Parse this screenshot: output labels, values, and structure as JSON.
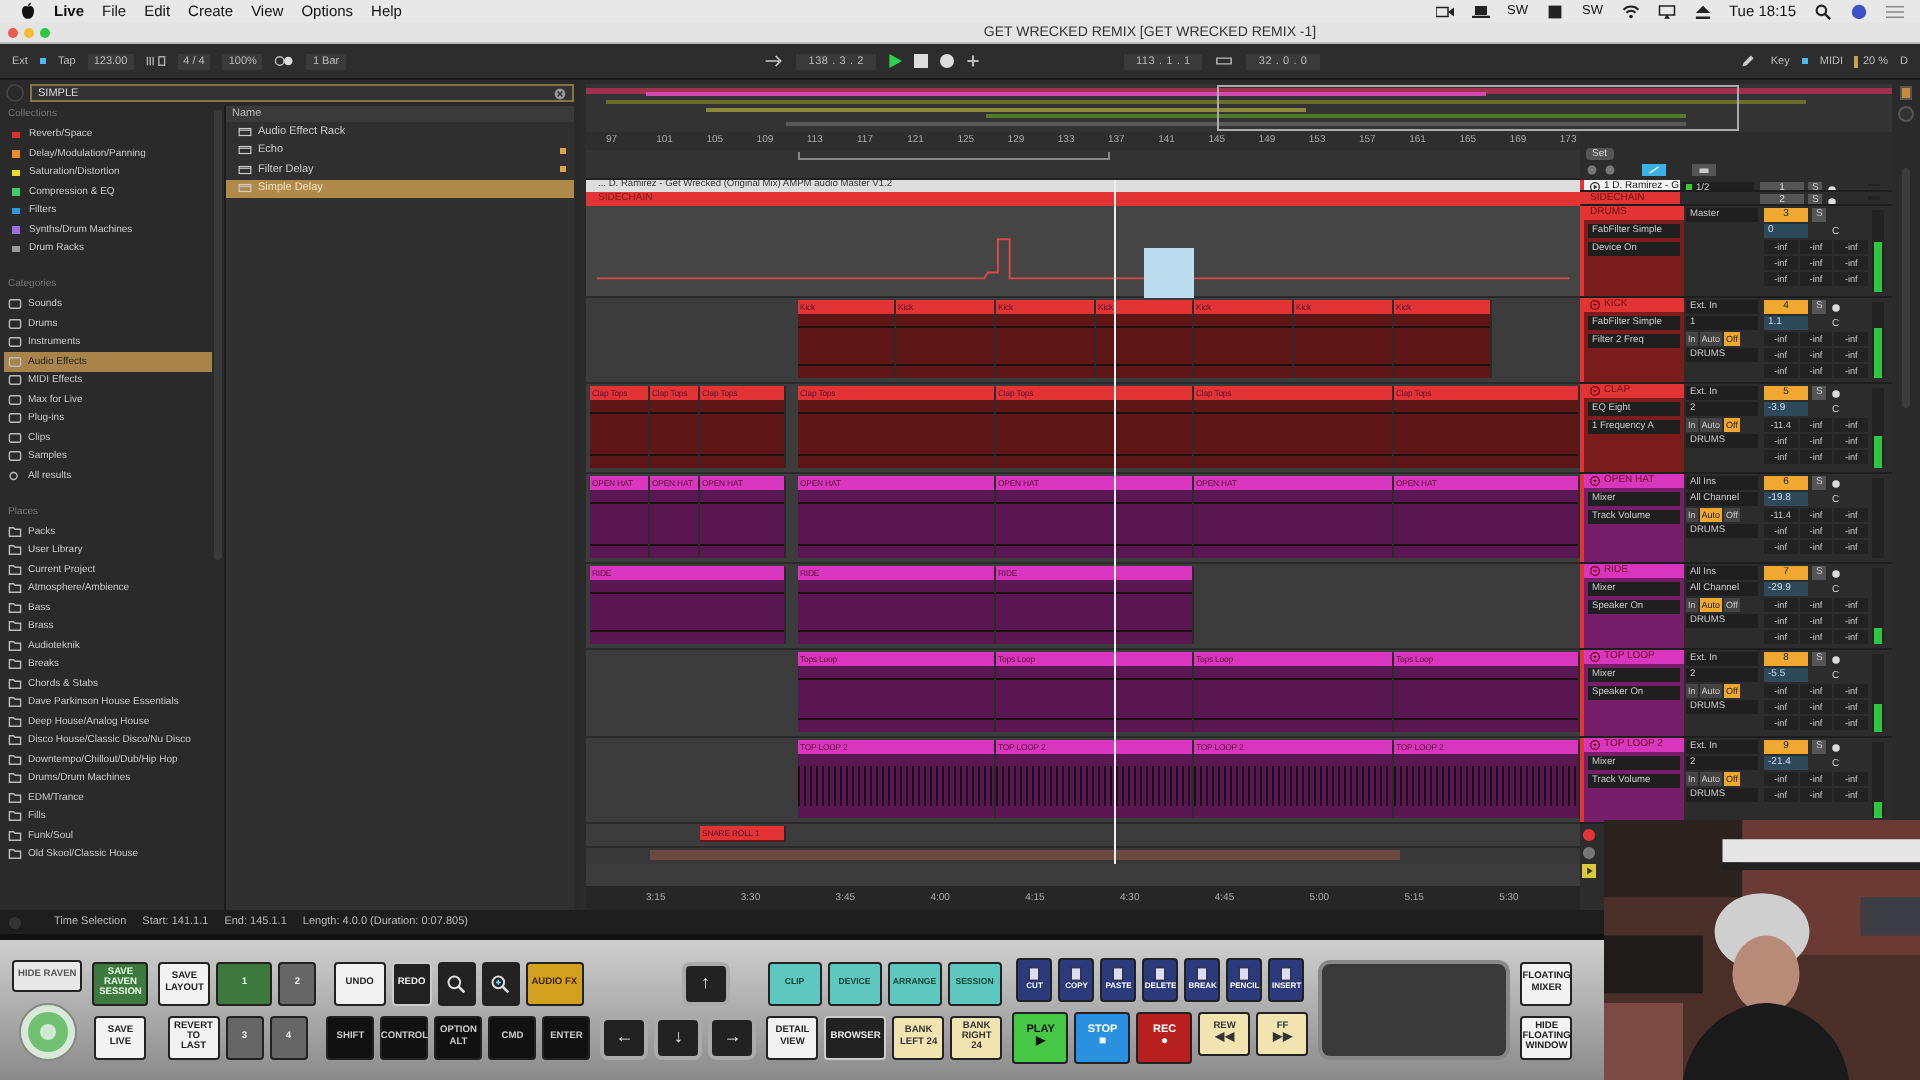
{
  "menubar": {
    "app": "Live",
    "menus": [
      "File",
      "Edit",
      "Create",
      "View",
      "Options",
      "Help"
    ],
    "extras": [
      "SW",
      "SW"
    ],
    "clock": "Tue 18:15"
  },
  "window": {
    "title": "GET WRECKED REMIX  [GET WRECKED REMIX -1]"
  },
  "control_bar": {
    "ext": "Ext",
    "tap": "Tap",
    "tempo": "123.00",
    "signature": "4 / 4",
    "zoom": "100%",
    "quantize": "1 Bar",
    "position": "138 .  3 .  2",
    "loop_start": "113 .  1 .  1",
    "loop_length": "32 .  0 .  0",
    "key": "Key",
    "midi": "MIDI",
    "cpu": "20 %",
    "disk": "D"
  },
  "browser": {
    "search": "SIMPLE",
    "collections_heading": "Collections",
    "collections": [
      {
        "label": "Reverb/Space",
        "color": "#e0302a"
      },
      {
        "label": "Delay/Modulation/Panning",
        "color": "#f08a24"
      },
      {
        "label": "Saturation/Distortion",
        "color": "#e8e02a"
      },
      {
        "label": "Compression & EQ",
        "color": "#3fd06a"
      },
      {
        "label": "Filters",
        "color": "#2a9ad8"
      },
      {
        "label": "Synths/Drum Machines",
        "color": "#9a6fe0"
      },
      {
        "label": "Drum Racks",
        "color": "#9a9a9a"
      }
    ],
    "categories_heading": "Categories",
    "categories": [
      {
        "label": "Sounds",
        "selected": false
      },
      {
        "label": "Drums",
        "selected": false
      },
      {
        "label": "Instruments",
        "selected": false
      },
      {
        "label": "Audio Effects",
        "selected": true
      },
      {
        "label": "MIDI Effects",
        "selected": false
      },
      {
        "label": "Max for Live",
        "selected": false
      },
      {
        "label": "Plug-ins",
        "selected": false
      },
      {
        "label": "Clips",
        "selected": false
      },
      {
        "label": "Samples",
        "selected": false
      },
      {
        "label": "All results",
        "selected": false
      }
    ],
    "places_heading": "Places",
    "places": [
      "Packs",
      "User Library",
      "Current Project",
      "Atmosphere/Ambience",
      "Bass",
      "Brass",
      "Audioteknik",
      "Breaks",
      "Chords & Stabs",
      "Dave Parkinson House Essentials",
      "Deep House/Analog House",
      "Disco House/Classic Disco/Nu Disco",
      "Downtempo/Chillout/Dub/Hip Hop",
      "Drums/Drum Machines",
      "EDM/Trance",
      "Fills",
      "Funk/Soul",
      "Old Skool/Classic House"
    ],
    "name_heading": "Name",
    "items": [
      {
        "label": "Audio Effect Rack",
        "selected": false,
        "marked": false
      },
      {
        "label": "Echo",
        "selected": false,
        "marked": true
      },
      {
        "label": "Filter Delay",
        "selected": false,
        "marked": true
      },
      {
        "label": "Simple Delay",
        "selected": true,
        "marked": false
      }
    ]
  },
  "arrangement": {
    "ruler": [
      "97",
      "101",
      "105",
      "109",
      "113",
      "117",
      "121",
      "125",
      "129",
      "133",
      "137",
      "141",
      "145",
      "149",
      "153",
      "157",
      "161",
      "165",
      "169",
      "173"
    ],
    "lanes": [
      {
        "kind": "title",
        "label": "... D. Ramirez - Get Wrecked (Original Mix) AMPM audio Master V1.2"
      },
      {
        "kind": "header",
        "label": "SIDECHAIN",
        "color": "#e23434"
      },
      {
        "kind": "automation"
      },
      {
        "kind": "clips",
        "color": "#e23434",
        "clips": [
          "Kick",
          "Kick",
          "Kick",
          "Kick",
          "Kick",
          "Kick",
          "Kick"
        ]
      },
      {
        "kind": "clips",
        "color": "#e23434",
        "clips": [
          "Clap Tops",
          "Clap Tops",
          "Clap Tops",
          "Clap Tops",
          "Clap Tops",
          "Clap Tops",
          "Clap Tops"
        ]
      },
      {
        "kind": "clips",
        "color": "#d936c0",
        "clips": [
          "OPEN HAT",
          "OPEN HAT",
          "OPEN HAT",
          "OPEN HAT",
          "OPEN HAT",
          "OPEN HAT",
          "OPEN HAT"
        ]
      },
      {
        "kind": "clips",
        "color": "#d936c0",
        "clips": [
          "RIDE",
          "RIDE",
          "RIDE"
        ]
      },
      {
        "kind": "clips",
        "color": "#d936c0",
        "clips": [
          "Tops Loop",
          "Tops Loop",
          "Tops Loop",
          "Tops Loop"
        ]
      },
      {
        "kind": "clips",
        "color": "#d936c0",
        "clips": [
          "TOP LOOP 2",
          "TOP LOOP 2",
          "TOP LOOP 2",
          "TOP LOOP 2"
        ]
      },
      {
        "kind": "clips",
        "color": "#e23434",
        "clips": [
          "SNARE ROLL 1"
        ]
      }
    ],
    "time_ruler": [
      "3:15",
      "3:30",
      "3:45",
      "4:00",
      "4:15",
      "4:30",
      "4:45",
      "5:00",
      "5:15",
      "5:30"
    ]
  },
  "track_panel": {
    "set": "Set"
  },
  "tracks": [
    {
      "kind": "audio",
      "name": "1 D. Ramirez - G",
      "input": "1/2",
      "number": "1",
      "solo": "S",
      "active": false
    },
    {
      "kind": "mini",
      "name": "SIDECHAIN",
      "color": "#e23434",
      "number": "2",
      "solo": "S",
      "active": false
    },
    {
      "kind": "group",
      "name": "DRUMS",
      "color": "#e23434",
      "output": "Master",
      "number": "3",
      "solo": "S",
      "active": true,
      "volume": "0",
      "pan": "C",
      "devices": [
        "FabFilter Simple",
        "Device On"
      ],
      "meters": [
        "-inf",
        "-inf",
        "-inf",
        "-inf",
        "-inf",
        "-inf",
        "-inf",
        "-inf",
        "-inf"
      ],
      "level": 0.6
    },
    {
      "kind": "track",
      "name": "KICK",
      "color": "#e23434",
      "input": "Ext. In",
      "channel": "1",
      "monitor": [
        {
          "label": "In",
          "selected": false
        },
        {
          "label": "Auto",
          "selected": false
        },
        {
          "label": "Off",
          "selected": true
        }
      ],
      "output": "DRUMS",
      "number": "4",
      "solo": "S",
      "active": true,
      "volume": "1.1",
      "pan": "C",
      "devices": [
        "FabFilter Simple",
        "Filter 2 Freq"
      ],
      "meters": [
        "-inf",
        "-inf",
        "-inf",
        "-inf",
        "-inf",
        "-inf",
        "-inf",
        "-inf",
        "-inf"
      ],
      "level": 0.65
    },
    {
      "kind": "track",
      "name": "CLAP",
      "color": "#e23434",
      "input": "Ext. In",
      "channel": "2",
      "monitor": [
        {
          "label": "In",
          "selected": false
        },
        {
          "label": "Auto",
          "selected": false
        },
        {
          "label": "Off",
          "selected": true
        }
      ],
      "output": "DRUMS",
      "number": "5",
      "solo": "S",
      "active": true,
      "volume": "-3.9",
      "pan": "C",
      "devices": [
        "EQ Eight",
        "1 Frequency A"
      ],
      "meters": [
        "-11.4",
        "-inf",
        "-inf",
        "-inf",
        "-inf",
        "-inf",
        "-inf",
        "-inf",
        "-inf"
      ],
      "level": 0.4
    },
    {
      "kind": "track",
      "name": "OPEN HAT",
      "color": "#d936c0",
      "input": "All Ins",
      "channel": "All Channel",
      "monitor": [
        {
          "label": "In",
          "selected": false
        },
        {
          "label": "Auto",
          "selected": true
        },
        {
          "label": "Off",
          "selected": false
        }
      ],
      "output": "DRUMS",
      "number": "6",
      "solo": "S",
      "active": true,
      "volume": "-19.8",
      "pan": "C",
      "devices": [
        "Mixer",
        "Track Volume"
      ],
      "meters": [
        "-11.4",
        "-inf",
        "-inf",
        "-inf",
        "-inf",
        "-inf",
        "-inf",
        "-inf",
        "-inf"
      ],
      "level": 0
    },
    {
      "kind": "track",
      "name": "RIDE",
      "color": "#d936c0",
      "input": "All Ins",
      "channel": "All Channel",
      "monitor": [
        {
          "label": "In",
          "selected": false
        },
        {
          "label": "Auto",
          "selected": true
        },
        {
          "label": "Off",
          "selected": false
        }
      ],
      "output": "DRUMS",
      "number": "7",
      "solo": "S",
      "active": true,
      "volume": "-29.9",
      "pan": "C",
      "devices": [
        "Mixer",
        "Speaker On"
      ],
      "meters": [
        "-inf",
        "-inf",
        "-inf",
        "-inf",
        "-inf",
        "-inf",
        "-inf",
        "-inf",
        "-inf"
      ],
      "level": 0.2
    },
    {
      "kind": "track",
      "name": "TOP LOOP",
      "color": "#d936c0",
      "input": "Ext. In",
      "channel": "2",
      "monitor": [
        {
          "label": "In",
          "selected": false
        },
        {
          "label": "Auto",
          "selected": false
        },
        {
          "label": "Off",
          "selected": true
        }
      ],
      "output": "DRUMS",
      "number": "8",
      "solo": "S",
      "active": true,
      "volume": "-5.5",
      "pan": "C",
      "devices": [
        "Mixer",
        "Speaker On"
      ],
      "meters": [
        "-inf",
        "-inf",
        "-inf",
        "-inf",
        "-inf",
        "-inf",
        "-inf",
        "-inf",
        "-inf"
      ],
      "level": 0.35
    },
    {
      "kind": "track",
      "name": "TOP LOOP 2",
      "color": "#d936c0",
      "input": "Ext. In",
      "channel": "2",
      "monitor": [
        {
          "label": "In",
          "selected": false
        },
        {
          "label": "Auto",
          "selected": false
        },
        {
          "label": "Off",
          "selected": true
        }
      ],
      "output": "DRUMS",
      "number": "9",
      "solo": "S",
      "active": true,
      "volume": "-21.4",
      "pan": "C",
      "devices": [
        "Mixer",
        "Track Volume"
      ],
      "meters": [
        "-inf",
        "-inf",
        "-inf",
        "-inf",
        "-inf",
        "-inf"
      ],
      "level": 0.2
    }
  ],
  "status_bar": [
    "Time Selection",
    "Start: 141.1.1",
    "End: 145.1.1",
    "Length: 4.0.0 (Duration: 0:07.805)"
  ],
  "controller": {
    "groups": [
      {
        "rows": [
          [
            {
              "label": "HIDE RAVEN",
              "kind": "tab"
            }
          ],
          [
            {
              "kind": "jog"
            }
          ]
        ]
      },
      {
        "rows": [
          [
            {
              "label": "SAVE RAVEN SESSION",
              "kind": "green"
            }
          ],
          [
            {
              "label": "SAVE LIVE",
              "kind": "light"
            }
          ]
        ]
      },
      {
        "rows": [
          [
            {
              "label": "SAVE LAYOUT",
              "kind": "light"
            },
            {
              "label": "1",
              "kind": "green"
            },
            {
              "label": "2",
              "kind": "grey"
            }
          ],
          [
            {
              "label": "REVERT TO LAST",
              "kind": "light"
            },
            {
              "label": "3",
              "kind": "grey"
            },
            {
              "label": "4",
              "kind": "grey"
            }
          ]
        ]
      },
      {
        "rows": [
          [
            {
              "label": "UNDO",
              "kind": "light"
            },
            {
              "label": "REDO",
              "kind": "dark"
            },
            {
              "kind": "zoom-out"
            },
            {
              "kind": "zoom-in"
            },
            {
              "label": "AUDIO FX",
              "kind": "gold"
            }
          ],
          [
            {
              "label": "SHIFT",
              "kind": "black"
            },
            {
              "label": "CONTROL",
              "kind": "black"
            },
            {
              "label": "OPTION ALT",
              "kind": "black"
            },
            {
              "label": "CMD",
              "kind": "black"
            },
            {
              "label": "ENTER",
              "kind": "black"
            }
          ]
        ]
      },
      {
        "rows": [
          [
            "",
            {
              "label": "↑",
              "kind": "arrow"
            }
          ],
          [
            {
              "label": "←",
              "kind": "arrow"
            },
            {
              "label": "↓",
              "kind": "arrow"
            },
            {
              "label": "→",
              "kind": "arrow"
            }
          ]
        ]
      },
      {
        "rows": [
          [
            {
              "label": "CLIP",
              "kind": "teal"
            },
            {
              "label": "DEVICE",
              "kind": "teal"
            },
            {
              "label": "ARRANGE",
              "kind": "teal"
            },
            {
              "label": "SESSION",
              "kind": "teal"
            }
          ],
          [
            {
              "label": "DETAIL VIEW",
              "kind": "light"
            },
            {
              "label": "BROWSER",
              "kind": "dark"
            },
            {
              "label": "BANK LEFT 24",
              "kind": "cream"
            },
            {
              "label": "BANK RIGHT 24",
              "kind": "cream"
            }
          ]
        ]
      },
      {
        "toolbar": [
          {
            "label": "CUT",
            "kind": "tool"
          },
          {
            "label": "COPY",
            "kind": "tool"
          },
          {
            "label": "PASTE",
            "kind": "tool"
          },
          {
            "label": "DELETE",
            "kind": "tool"
          },
          {
            "label": "BREAK",
            "kind": "tool"
          },
          {
            "label": "PENCIL",
            "kind": "tool"
          },
          {
            "label": "INSERT",
            "kind": "tool"
          }
        ],
        "transport": [
          {
            "label": "PLAY",
            "symbol": "▶",
            "kind": "play"
          },
          {
            "label": "STOP",
            "symbol": "■",
            "kind": "stop"
          },
          {
            "label": "REC",
            "symbol": "●",
            "kind": "rec"
          },
          {
            "label": "REW",
            "symbol": "◀◀",
            "kind": "cream"
          },
          {
            "label": "FF",
            "symbol": "▶▶",
            "kind": "cream"
          }
        ]
      },
      {
        "rows": [
          [
            {
              "kind": "trackpad"
            }
          ]
        ]
      },
      {
        "rows": [
          [
            {
              "label": "FLOATING MIXER",
              "kind": "light"
            }
          ],
          [
            {
              "label": "HIDE FLOATING WINDOW",
              "kind": "light"
            }
          ]
        ]
      }
    ]
  }
}
